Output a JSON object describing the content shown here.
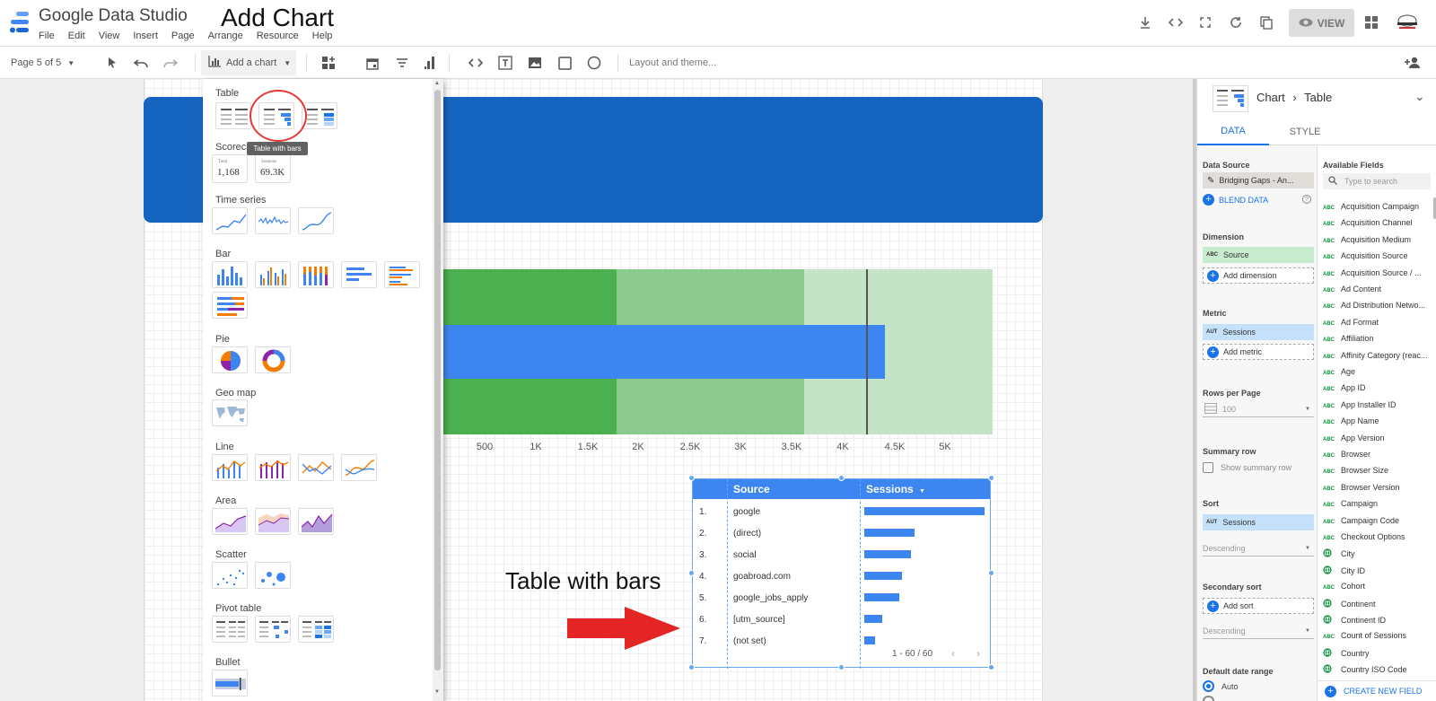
{
  "app": {
    "title": "Google Data Studio",
    "overlay_title": "Add Chart"
  },
  "menu": [
    "File",
    "Edit",
    "View",
    "Insert",
    "Page",
    "Arrange",
    "Resource",
    "Help"
  ],
  "header": {
    "view_label": "VIEW"
  },
  "toolbar": {
    "page_indicator": "Page 5 of 5",
    "add_chart_label": "Add a chart",
    "layout_theme_label": "Layout and theme..."
  },
  "chart_menu": {
    "categories": [
      "Table",
      "Scorecard",
      "Time series",
      "Bar",
      "Pie",
      "Geo map",
      "Line",
      "Area",
      "Scatter",
      "Pivot table",
      "Bullet"
    ],
    "tooltip": "Table with bars",
    "scorecard_1": {
      "label": "Total",
      "value": "1,168"
    },
    "scorecard_2": {
      "label": "Sessions",
      "value": "69.3K"
    }
  },
  "bullet_chart": {
    "axis_ticks": [
      "500",
      "1K",
      "1.5K",
      "2K",
      "2.5K",
      "3K",
      "3.5K",
      "4K",
      "4.5K",
      "5K"
    ]
  },
  "table": {
    "columns": [
      "Source",
      "Sessions"
    ],
    "rows": [
      {
        "idx": "1.",
        "source": "google",
        "sessions_fraction": 1.0
      },
      {
        "idx": "2.",
        "source": "(direct)",
        "sessions_fraction": 0.42
      },
      {
        "idx": "3.",
        "source": "social",
        "sessions_fraction": 0.39
      },
      {
        "idx": "4.",
        "source": "goabroad.com",
        "sessions_fraction": 0.31
      },
      {
        "idx": "5.",
        "source": "google_jobs_apply",
        "sessions_fraction": 0.29
      },
      {
        "idx": "6.",
        "source": "[utm_source]",
        "sessions_fraction": 0.15
      },
      {
        "idx": "7.",
        "source": "(not set)",
        "sessions_fraction": 0.09
      }
    ],
    "pagination": "1 - 60 / 60"
  },
  "annotation": "Table with bars",
  "panel": {
    "breadcrumb_chart": "Chart",
    "breadcrumb_type": "Table",
    "tab_data": "DATA",
    "tab_style": "STYLE",
    "data_source_label": "Data Source",
    "data_source_value": "Bridging Gaps - An...",
    "blend_data": "BLEND DATA",
    "dimension_label": "Dimension",
    "dimension_value": "Source",
    "dimension_tag": "ABC",
    "add_dimension": "Add dimension",
    "metric_label": "Metric",
    "metric_value": "Sessions",
    "metric_tag": "AUT",
    "add_metric": "Add metric",
    "rows_per_page_label": "Rows per Page",
    "rows_per_page_value": "100",
    "summary_row_label": "Summary row",
    "show_summary_row": "Show summary row",
    "sort_label": "Sort",
    "sort_value": "Sessions",
    "sort_order": "Descending",
    "secondary_sort_label": "Secondary sort",
    "add_sort": "Add sort",
    "secondary_order": "Descending",
    "date_range_label": "Default date range",
    "date_range_auto": "Auto",
    "available_fields_label": "Available Fields",
    "search_placeholder": "Type to search",
    "create_new_field": "CREATE NEW FIELD",
    "fields": [
      "Acquisition Campaign",
      "Acquisition Channel",
      "Acquisition Medium",
      "Acquisition Source",
      "Acquisition Source / ...",
      "Ad Content",
      "Ad Distribution Netwo...",
      "Ad Format",
      "Affiliation",
      "Affinity Category (reac...",
      "Age",
      "App ID",
      "App Installer ID",
      "App Name",
      "App Version",
      "Browser",
      "Browser Size",
      "Browser Version",
      "Campaign",
      "Campaign Code",
      "Checkout Options",
      "City",
      "City ID",
      "Cohort",
      "Continent",
      "Continent ID",
      "Count of Sessions",
      "Country",
      "Country ISO Code"
    ]
  },
  "colors": {
    "accent": "#1a73e8",
    "banner": "#1565c0",
    "bar_blue": "#3d85f0",
    "green_dark": "#4caf50",
    "green_mid": "#8bc98c",
    "green_light": "#c5e3c6",
    "annotation_red": "#e53935"
  }
}
